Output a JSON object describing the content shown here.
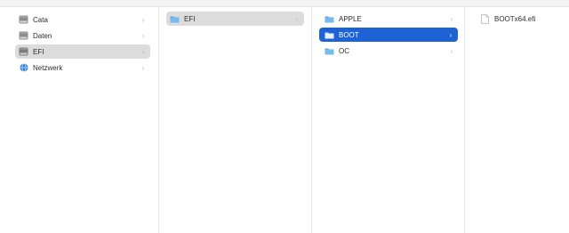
{
  "sidebar": {
    "items": [
      {
        "label": "Cata",
        "icon": "disk-icon"
      },
      {
        "label": "Daten",
        "icon": "disk-icon"
      },
      {
        "label": "EFI",
        "icon": "disk-icon"
      },
      {
        "label": "Netzwerk",
        "icon": "network-globe-icon"
      }
    ]
  },
  "column2": {
    "items": [
      {
        "label": "EFI",
        "icon": "folder-icon"
      }
    ]
  },
  "column3": {
    "items": [
      {
        "label": "APPLE",
        "icon": "folder-icon"
      },
      {
        "label": "BOOT",
        "icon": "folder-icon"
      },
      {
        "label": "OC",
        "icon": "folder-icon"
      }
    ]
  },
  "column4": {
    "items": [
      {
        "label": "BOOTx64.efi",
        "icon": "file-icon"
      }
    ]
  },
  "chevron": "›",
  "colors": {
    "selection_blue": "#1e63d5",
    "selection_grey": "#dcdcdc",
    "folder_blue": "#5aaae6"
  }
}
